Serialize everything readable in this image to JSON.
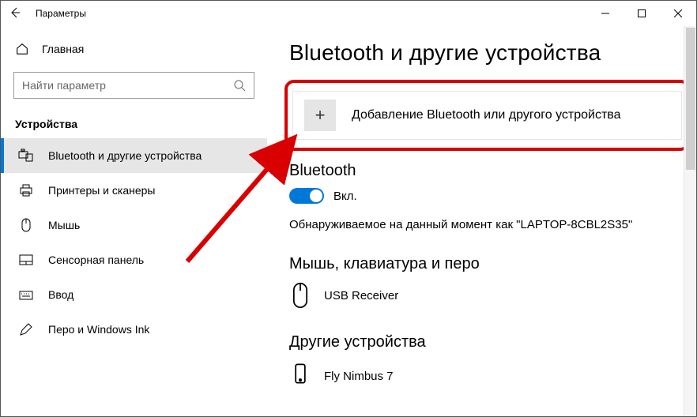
{
  "titlebar": {
    "app_name": "Параметры"
  },
  "sidebar": {
    "home_label": "Главная",
    "search_placeholder": "Найти параметр",
    "group_label": "Устройства",
    "items": [
      {
        "label": "Bluetooth и другие устройства"
      },
      {
        "label": "Принтеры и сканеры"
      },
      {
        "label": "Мышь"
      },
      {
        "label": "Сенсорная панель"
      },
      {
        "label": "Ввод"
      },
      {
        "label": "Перо и Windows Ink"
      }
    ]
  },
  "content": {
    "page_title": "Bluetooth и другие устройства",
    "add_device_label": "Добавление Bluetooth или другого устройства",
    "bt_section": "Bluetooth",
    "bt_state": "Вкл.",
    "discoverable_text": "Обнаруживаемое на данный момент как \"LAPTOP-8CBL2S35\"",
    "mouse_section": "Мышь, клавиатура и перо",
    "mouse_device": "USB Receiver",
    "other_section": "Другие устройства",
    "other_device": "Fly Nimbus 7"
  }
}
